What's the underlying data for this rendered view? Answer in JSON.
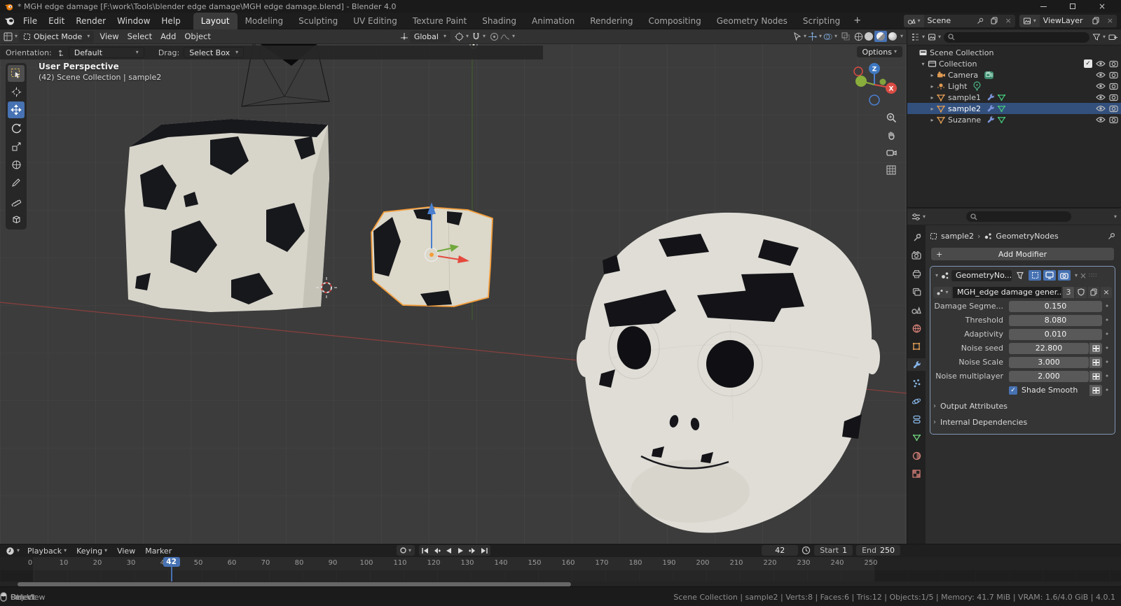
{
  "icons": {
    "caret_down": "▾",
    "chevron_right": "›",
    "plus": "+",
    "close": "×",
    "check": "✓",
    "dot": "•",
    "users_badge": "3"
  },
  "window": {
    "title": "* MGH edge damage [F:\\work\\Tools\\blender edge damage\\MGH edge damage.blend] - Blender 4.0"
  },
  "topbar": {
    "menus": [
      "File",
      "Edit",
      "Render",
      "Window",
      "Help"
    ],
    "workspaces": [
      {
        "label": "Layout",
        "active": true
      },
      {
        "label": "Modeling"
      },
      {
        "label": "Sculpting"
      },
      {
        "label": "UV Editing"
      },
      {
        "label": "Texture Paint"
      },
      {
        "label": "Shading"
      },
      {
        "label": "Animation"
      },
      {
        "label": "Rendering"
      },
      {
        "label": "Compositing"
      },
      {
        "label": "Geometry Nodes"
      },
      {
        "label": "Scripting"
      }
    ],
    "scene_name": "Scene",
    "viewlayer_name": "ViewLayer"
  },
  "viewport": {
    "mode": "Object Mode",
    "menus": [
      "View",
      "Select",
      "Add",
      "Object"
    ],
    "orientation": "Global",
    "tool_settings": {
      "orientation_label": "Orientation:",
      "orientation_value": "Default",
      "drag_label": "Drag:",
      "drag_value": "Select Box"
    },
    "options_label": "Options",
    "overlay": {
      "view_name": "User Perspective",
      "context": "(42) Scene Collection | sample2"
    },
    "gizmo": {
      "z_label": "Z",
      "x_label": "X"
    }
  },
  "outliner": {
    "rows": [
      {
        "label": "Scene Collection",
        "icon": "scene-collection",
        "depth": 0,
        "arrow": ""
      },
      {
        "label": "Collection",
        "icon": "collection",
        "depth": 1,
        "arrow": "▾",
        "checkbox": true,
        "eye": true,
        "cam": true
      },
      {
        "label": "Camera",
        "icon": "camera",
        "depth": 2,
        "arrow": "▸",
        "badge": "camera-data",
        "eye": true,
        "cam": true
      },
      {
        "label": "Light",
        "icon": "light",
        "depth": 2,
        "arrow": "▸",
        "badge": "light-data",
        "eye": true,
        "cam": true
      },
      {
        "label": "sample1",
        "icon": "mesh",
        "depth": 2,
        "arrow": "▸",
        "mods": true,
        "eye": true,
        "cam": true
      },
      {
        "label": "sample2",
        "icon": "mesh",
        "depth": 2,
        "arrow": "▸",
        "mods": true,
        "selected": true,
        "eye": true,
        "cam": true
      },
      {
        "label": "Suzanne",
        "icon": "mesh",
        "depth": 2,
        "arrow": "▸",
        "mods": true,
        "eye": true,
        "cam": true
      }
    ]
  },
  "properties": {
    "breadcrumb": {
      "object": "sample2",
      "target": "GeometryNodes"
    },
    "add_modifier_label": "Add Modifier",
    "modifier": {
      "name": "GeometryNo...",
      "node_group": "MGH_edge damage gener...",
      "users": "3",
      "params": [
        {
          "label": "Damage Segme...",
          "value": "0.150"
        },
        {
          "label": "Threshold",
          "value": "8.080"
        },
        {
          "label": "Adaptivity",
          "value": "0.010"
        },
        {
          "label": "Noise seed",
          "value": "22.800",
          "attr": true
        },
        {
          "label": "Noise Scale",
          "value": "3.000",
          "attr": true
        },
        {
          "label": "Noise multiplayer",
          "value": "2.000",
          "attr": true
        }
      ],
      "shade_smooth_label": "Shade Smooth",
      "sections": [
        {
          "label": "Output Attributes"
        },
        {
          "label": "Internal Dependencies"
        }
      ]
    }
  },
  "timeline": {
    "menus": [
      {
        "label": "Playback",
        "caret": true
      },
      {
        "label": "Keying",
        "caret": true
      },
      {
        "label": "View"
      },
      {
        "label": "Marker"
      }
    ],
    "current_frame": "42",
    "start_label": "Start",
    "start_value": "1",
    "end_label": "End",
    "end_value": "250",
    "ticks": [
      0,
      10,
      20,
      30,
      40,
      50,
      60,
      70,
      80,
      90,
      100,
      110,
      120,
      130,
      140,
      150,
      160,
      170,
      180,
      190,
      200,
      210,
      220,
      230,
      240,
      250
    ]
  },
  "statusbar": {
    "keymap": [
      {
        "label": "Select",
        "icon": "mouse-left"
      },
      {
        "label": "Pan View",
        "icon": "mouse-middle"
      },
      {
        "label": "Object",
        "icon": "mouse-right"
      }
    ],
    "stats": "Scene Collection | sample2 | Verts:8 | Faces:6 | Tris:12 | Objects:1/5 | Memory: 41.7 MiB | VRAM: 1.6/4.0 GiB | 4.0.1"
  },
  "colors": {
    "accent": "#4772b3",
    "selection_outline": "#f49d3a",
    "axis_x": "#e5493d",
    "axis_y": "#71a83b",
    "axis_z": "#4a7fd0"
  }
}
